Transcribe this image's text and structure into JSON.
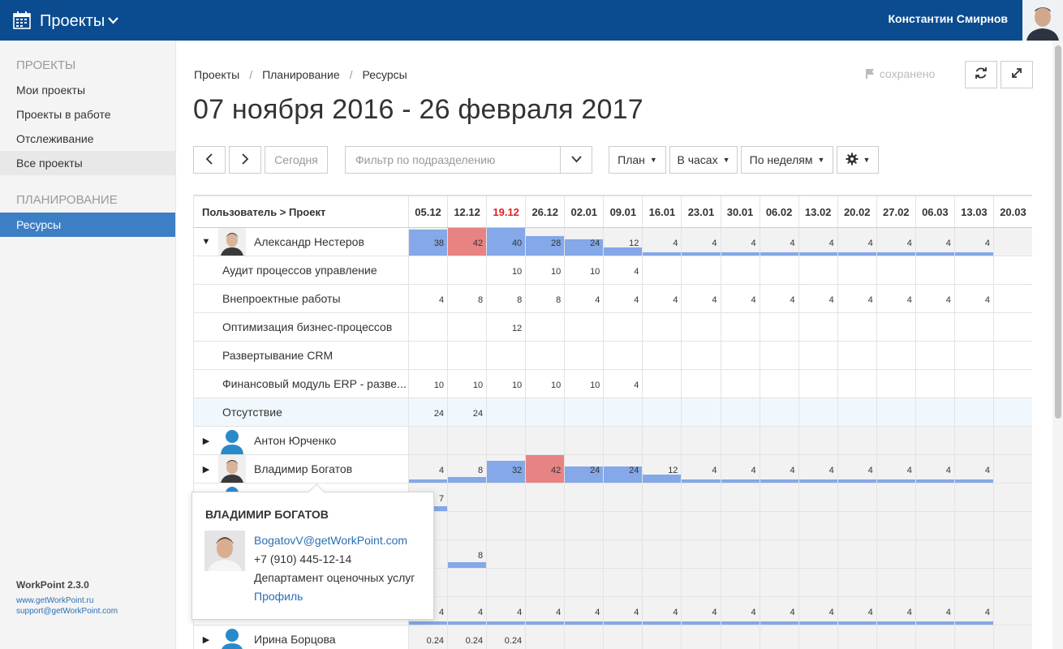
{
  "topbar": {
    "title": "Проекты",
    "user": "Константин Смирнов"
  },
  "sidebar": {
    "sections": [
      {
        "heading": "ПРОЕКТЫ",
        "items": [
          "Мои проекты",
          "Проекты в работе",
          "Отслеживание",
          "Все проекты"
        ]
      },
      {
        "heading": "ПЛАНИРОВАНИЕ",
        "items": [
          "Ресурсы"
        ]
      }
    ],
    "active_item": "Ресурсы",
    "footer": {
      "version": "WorkPoint 2.3.0",
      "site": "www.getWorkPoint.ru",
      "support": "support@getWorkPoint.com"
    }
  },
  "breadcrumb": [
    "Проекты",
    "Планирование",
    "Ресурсы"
  ],
  "saved_label": "сохранено",
  "page_title": "07 ноября 2016 - 26 февраля 2017",
  "toolbar": {
    "prev": "<",
    "next": ">",
    "today": "Сегодня",
    "filter_placeholder": "Фильтр по подразделению",
    "plan": "План",
    "units": "В часах",
    "period": "По неделям"
  },
  "colors": {
    "topbar": "#0b4c90",
    "accent": "#3d7fc4",
    "load_ok": "#84a8e8",
    "overload": "#e88383",
    "current_week": "#e02020"
  },
  "grid": {
    "name_header": "Пользователь > Проект",
    "weeks": [
      "05.12",
      "12.12",
      "19.12",
      "26.12",
      "02.01",
      "09.01",
      "16.01",
      "23.01",
      "30.01",
      "06.02",
      "13.02",
      "20.02",
      "27.02",
      "06.03",
      "13.03",
      "20.03"
    ],
    "current_week_index": 2,
    "rows": [
      {
        "type": "user",
        "expanded": true,
        "name": "Александр Нестеров",
        "avatar": "photo",
        "values": [
          "38",
          "42",
          "40",
          "28",
          "24",
          "12",
          "4",
          "4",
          "4",
          "4",
          "4",
          "4",
          "4",
          "4",
          "4",
          ""
        ],
        "load": [
          0.95,
          1.05,
          1.0,
          0.7,
          0.6,
          0.3,
          0.1,
          0.1,
          0.1,
          0.1,
          0.1,
          0.1,
          0.1,
          0.1,
          0.1,
          0
        ]
      },
      {
        "type": "project",
        "name": "Аудит процессов управление",
        "values": [
          "",
          "",
          "10",
          "10",
          "10",
          "4",
          "",
          "",
          "",
          "",
          "",
          "",
          "",
          "",
          "",
          ""
        ]
      },
      {
        "type": "project",
        "name": "Внепроектные работы",
        "values": [
          "4",
          "8",
          "8",
          "8",
          "4",
          "4",
          "4",
          "4",
          "4",
          "4",
          "4",
          "4",
          "4",
          "4",
          "4",
          ""
        ]
      },
      {
        "type": "project",
        "name": "Оптимизация бизнес-процессов",
        "values": [
          "",
          "",
          "12",
          "",
          "",
          "",
          "",
          "",
          "",
          "",
          "",
          "",
          "",
          "",
          "",
          ""
        ]
      },
      {
        "type": "project",
        "name": "Развертывание CRM",
        "values": [
          "",
          "",
          "",
          "",
          "",
          "",
          "",
          "",
          "",
          "",
          "",
          "",
          "",
          "",
          "",
          ""
        ]
      },
      {
        "type": "project",
        "name": "Финансовый модуль ERP - разве...",
        "values": [
          "10",
          "10",
          "10",
          "10",
          "10",
          "4",
          "",
          "",
          "",
          "",
          "",
          "",
          "",
          "",
          "",
          ""
        ]
      },
      {
        "type": "absence",
        "name": "Отсутствие",
        "values": [
          "24",
          "24",
          "",
          "",
          "",
          "",
          "",
          "",
          "",
          "",
          "",
          "",
          "",
          "",
          "",
          ""
        ]
      },
      {
        "type": "user",
        "expanded": false,
        "name": "Антон Юрченко",
        "avatar": "placeholder",
        "values": [
          "",
          "",
          "",
          "",
          "",
          "",
          "",
          "",
          "",
          "",
          "",
          "",
          "",
          "",
          "",
          ""
        ],
        "load": [
          0,
          0,
          0,
          0,
          0,
          0,
          0,
          0,
          0,
          0,
          0,
          0,
          0,
          0,
          0,
          0
        ]
      },
      {
        "type": "user",
        "expanded": false,
        "name": "Владимир Богатов",
        "avatar": "photo",
        "values": [
          "4",
          "8",
          "32",
          "42",
          "24",
          "24",
          "12",
          "4",
          "4",
          "4",
          "4",
          "4",
          "4",
          "4",
          "4",
          ""
        ],
        "load": [
          0.1,
          0.2,
          0.8,
          1.05,
          0.6,
          0.6,
          0.3,
          0.1,
          0.1,
          0.1,
          0.1,
          0.1,
          0.1,
          0.1,
          0.1,
          0
        ]
      },
      {
        "type": "user",
        "expanded": false,
        "name": "",
        "avatar": "placeholder",
        "values": [
          "7",
          "",
          "",
          "",
          "",
          "",
          "",
          "",
          "",
          "",
          "",
          "",
          "",
          "",
          "",
          ""
        ],
        "load": [
          0.18,
          0,
          0,
          0,
          0,
          0,
          0,
          0,
          0,
          0,
          0,
          0,
          0,
          0,
          0,
          0
        ]
      },
      {
        "type": "user",
        "expanded": false,
        "name": "",
        "avatar": "none",
        "values": [
          "",
          "",
          "",
          "",
          "",
          "",
          "",
          "",
          "",
          "",
          "",
          "",
          "",
          "",
          "",
          ""
        ],
        "load": [
          0,
          0,
          0,
          0,
          0,
          0,
          0,
          0,
          0,
          0,
          0,
          0,
          0,
          0,
          0,
          0
        ]
      },
      {
        "type": "user",
        "expanded": false,
        "name": "",
        "avatar": "none",
        "values": [
          "",
          "8",
          "",
          "",
          "",
          "",
          "",
          "",
          "",
          "",
          "",
          "",
          "",
          "",
          "",
          ""
        ],
        "load": [
          0,
          0.2,
          0,
          0,
          0,
          0,
          0,
          0,
          0,
          0,
          0,
          0,
          0,
          0,
          0,
          0
        ]
      },
      {
        "type": "user",
        "expanded": false,
        "name": "",
        "avatar": "none",
        "values": [
          "",
          "",
          "",
          "",
          "",
          "",
          "",
          "",
          "",
          "",
          "",
          "",
          "",
          "",
          "",
          ""
        ],
        "load": [
          0,
          0,
          0,
          0,
          0,
          0,
          0,
          0,
          0,
          0,
          0,
          0,
          0,
          0,
          0,
          0
        ]
      },
      {
        "type": "user",
        "expanded": false,
        "name": "",
        "avatar": "none",
        "values": [
          "4",
          "4",
          "4",
          "4",
          "4",
          "4",
          "4",
          "4",
          "4",
          "4",
          "4",
          "4",
          "4",
          "4",
          "4",
          ""
        ],
        "load": [
          0.1,
          0.1,
          0.1,
          0.1,
          0.1,
          0.1,
          0.1,
          0.1,
          0.1,
          0.1,
          0.1,
          0.1,
          0.1,
          0.1,
          0.1,
          0
        ]
      },
      {
        "type": "user",
        "expanded": false,
        "name": "Ирина Борцова",
        "avatar": "placeholder",
        "values": [
          "0.24",
          "0.24",
          "0.24",
          "",
          "",
          "",
          "",
          "",
          "",
          "",
          "",
          "",
          "",
          "",
          "",
          ""
        ],
        "load": [
          0.01,
          0.01,
          0.01,
          0,
          0,
          0,
          0,
          0,
          0,
          0,
          0,
          0,
          0,
          0,
          0,
          0
        ]
      }
    ]
  },
  "popover": {
    "name": "ВЛАДИМИР БОГАТОВ",
    "email": "BogatovV@getWorkPoint.com",
    "phone": "+7 (910) 445-12-14",
    "department": "Департамент оценочных услуг",
    "profile_link": "Профиль"
  }
}
